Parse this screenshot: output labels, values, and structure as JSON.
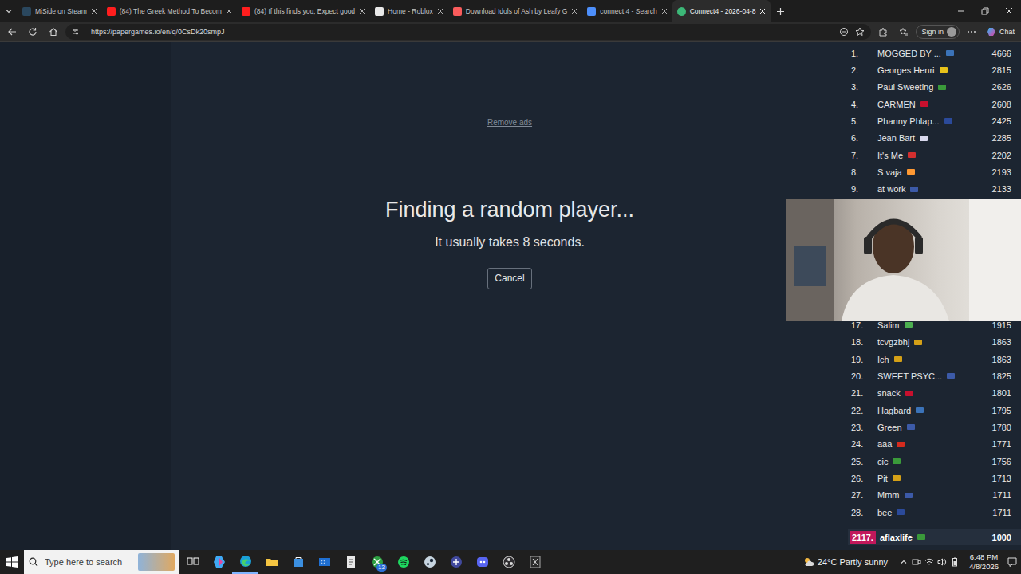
{
  "browser": {
    "tabs": [
      {
        "label": "MiSide on Steam",
        "selected": false
      },
      {
        "label": "(84) The Greek Method To Becom",
        "selected": false
      },
      {
        "label": "(84) If this finds you, Expect good",
        "selected": false
      },
      {
        "label": "Home - Roblox",
        "selected": false
      },
      {
        "label": "Download Idols of Ash by Leafy G",
        "selected": false
      },
      {
        "label": "connect 4 - Search",
        "selected": false
      },
      {
        "label": "Connect4 - 2026-04-8",
        "selected": true
      }
    ],
    "url": "https://papergames.io/en/q/0CsDk20smpJ",
    "sign_in": "Sign in",
    "chat": "Chat"
  },
  "page": {
    "remove_ads": "Remove ads",
    "heading": "Finding a random player...",
    "subtitle": "It usually takes 8 seconds.",
    "cancel": "Cancel"
  },
  "leaderboard": {
    "rows": [
      {
        "rank": "1.",
        "name": "MOGGED BY ...",
        "score": "4666",
        "color": "#3b73b9"
      },
      {
        "rank": "2.",
        "name": "Georges Henri",
        "score": "2815",
        "color": "#e8c21a"
      },
      {
        "rank": "3.",
        "name": "Paul Sweeting",
        "score": "2626",
        "color": "#3a9a3a"
      },
      {
        "rank": "4.",
        "name": "CARMEN",
        "score": "2608",
        "color": "#c8102e"
      },
      {
        "rank": "5.",
        "name": "Phanny Phlap...",
        "score": "2425",
        "color": "#2b4a9a"
      },
      {
        "rank": "6.",
        "name": "Jean Bart",
        "score": "2285",
        "color": "#d9d9ee"
      },
      {
        "rank": "7.",
        "name": "It's Me",
        "score": "2202",
        "color": "#d32f2f"
      },
      {
        "rank": "8.",
        "name": "S vaja",
        "score": "2193",
        "color": "#ff9933"
      },
      {
        "rank": "9.",
        "name": "at work",
        "score": "2133",
        "color": "#3c5aa8"
      },
      {
        "rank": "17.",
        "name": "Salim",
        "score": "1915",
        "color": "#4caf50"
      },
      {
        "rank": "18.",
        "name": "tcvgzbhj",
        "score": "1863",
        "color": "#d4a017"
      },
      {
        "rank": "19.",
        "name": "Ich",
        "score": "1863",
        "color": "#d4a017"
      },
      {
        "rank": "20.",
        "name": "SWEET PSYC...",
        "score": "1825",
        "color": "#3c5aa8"
      },
      {
        "rank": "21.",
        "name": "snack",
        "score": "1801",
        "color": "#c8102e"
      },
      {
        "rank": "22.",
        "name": "Hagbard",
        "score": "1795",
        "color": "#3b73b9"
      },
      {
        "rank": "23.",
        "name": "Green",
        "score": "1780",
        "color": "#3c5aa8"
      },
      {
        "rank": "24.",
        "name": "aaa",
        "score": "1771",
        "color": "#d52b1e"
      },
      {
        "rank": "25.",
        "name": "cic",
        "score": "1756",
        "color": "#3a9a3a"
      },
      {
        "rank": "26.",
        "name": "Pit",
        "score": "1713",
        "color": "#d4a017"
      },
      {
        "rank": "27.",
        "name": "Mmm",
        "score": "1711",
        "color": "#3c5aa8"
      },
      {
        "rank": "28.",
        "name": "bee",
        "score": "1711",
        "color": "#2b4a9a"
      }
    ],
    "user": {
      "rank": "2117.",
      "name": "aflaxlife",
      "score": "1000",
      "color": "#3a9a3a",
      "rank_color": "#c2185b"
    }
  },
  "taskbar": {
    "search_placeholder": "Type here to search",
    "xbox_badge": "13",
    "weather": "24°C Partly sunny",
    "time": "6:48 PM",
    "date": "4/8/2026"
  }
}
